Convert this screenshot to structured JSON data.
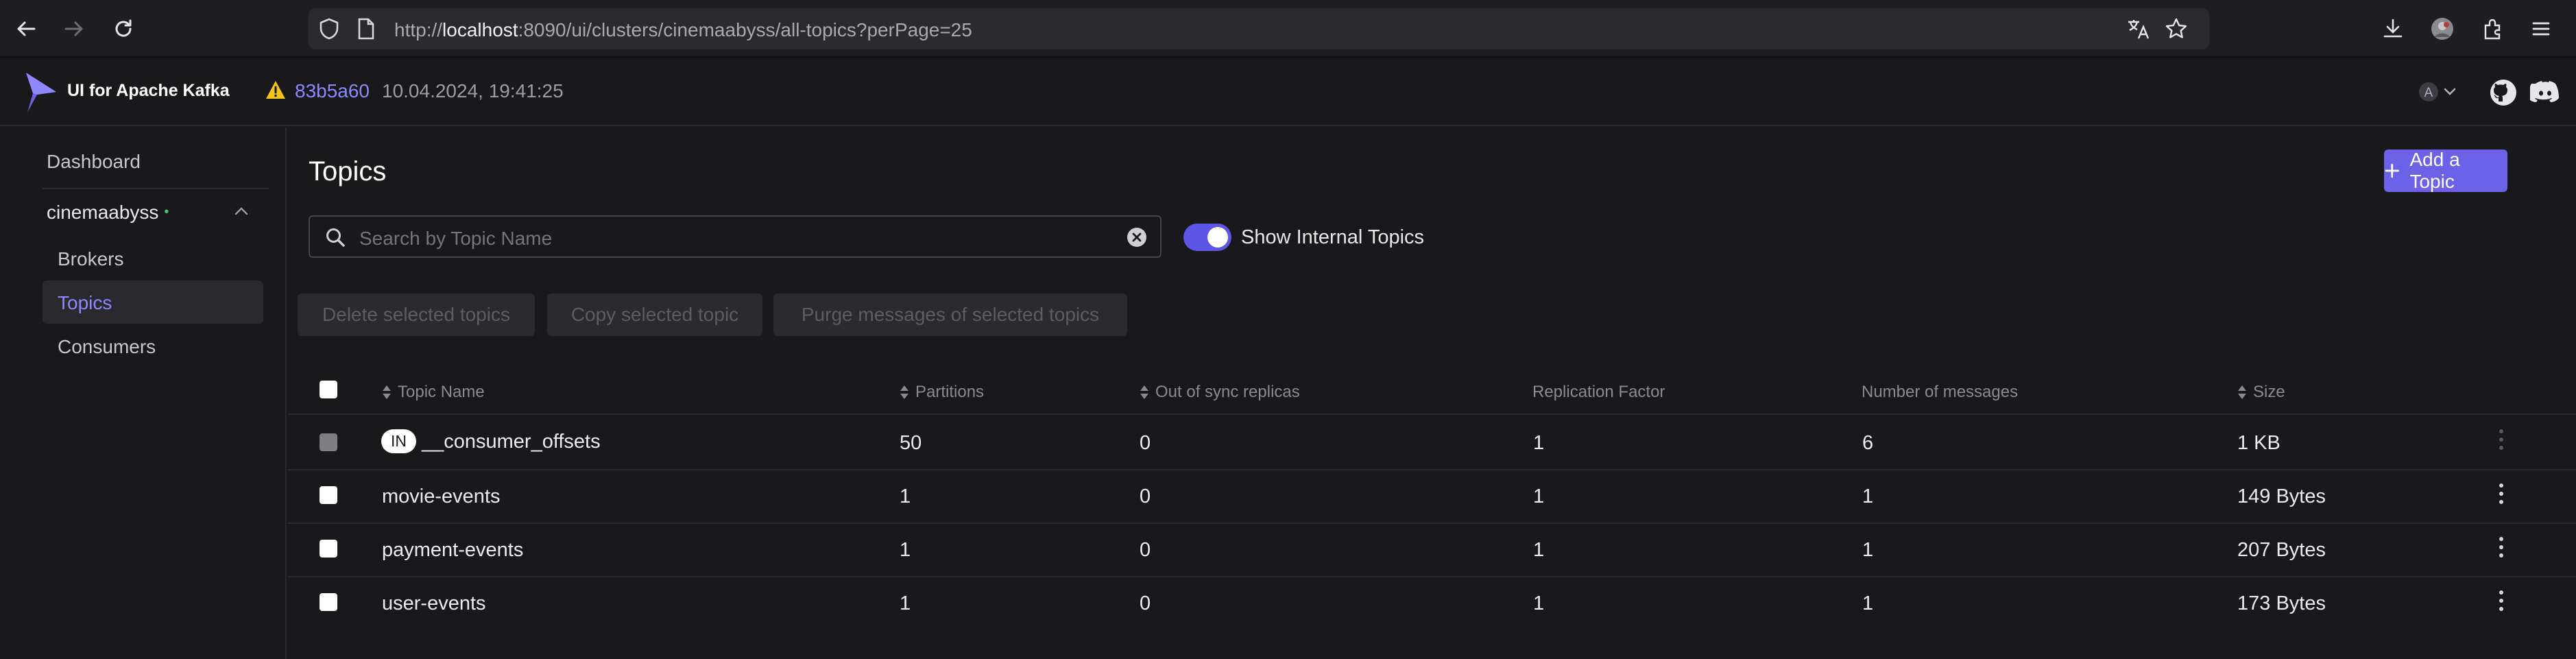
{
  "browser": {
    "url_prefix": "http://",
    "url_host": "localhost",
    "url_rest": ":8090/ui/clusters/cinemaabyss/all-topics?perPage=25"
  },
  "header": {
    "app_title": "UI for Apache Kafka",
    "commit": "83b5a60",
    "commit_date": "10.04.2024, 19:41:25",
    "user_initial": "A"
  },
  "sidebar": {
    "dashboard": "Dashboard",
    "cluster": "cinemaabyss",
    "cluster_status": "•",
    "items": [
      {
        "label": "Brokers"
      },
      {
        "label": "Topics"
      },
      {
        "label": "Consumers"
      }
    ]
  },
  "main": {
    "title": "Topics",
    "add_button": "Add a Topic",
    "search_placeholder": "Search by Topic Name",
    "toggle_label": "Show Internal Topics",
    "actions": {
      "delete": "Delete selected topics",
      "copy": "Copy selected topic",
      "purge": "Purge messages of selected topics"
    },
    "columns": {
      "name": "Topic Name",
      "partitions": "Partitions",
      "oos": "Out of sync replicas",
      "rf": "Replication Factor",
      "messages": "Number of messages",
      "size": "Size"
    },
    "internal_badge": "IN",
    "rows": [
      {
        "name": "__consumer_offsets",
        "partitions": "50",
        "oos": "0",
        "rf": "1",
        "messages": "6",
        "size": "1 KB"
      },
      {
        "name": "movie-events",
        "partitions": "1",
        "oos": "0",
        "rf": "1",
        "messages": "1",
        "size": "149 Bytes"
      },
      {
        "name": "payment-events",
        "partitions": "1",
        "oos": "0",
        "rf": "1",
        "messages": "1",
        "size": "207 Bytes"
      },
      {
        "name": "user-events",
        "partitions": "1",
        "oos": "0",
        "rf": "1",
        "messages": "1",
        "size": "173 Bytes"
      }
    ]
  },
  "colors": {
    "accent": "#6b62e8",
    "link": "#8e88ff",
    "status_ok": "#4bc37b",
    "warning": "#f5c518"
  }
}
